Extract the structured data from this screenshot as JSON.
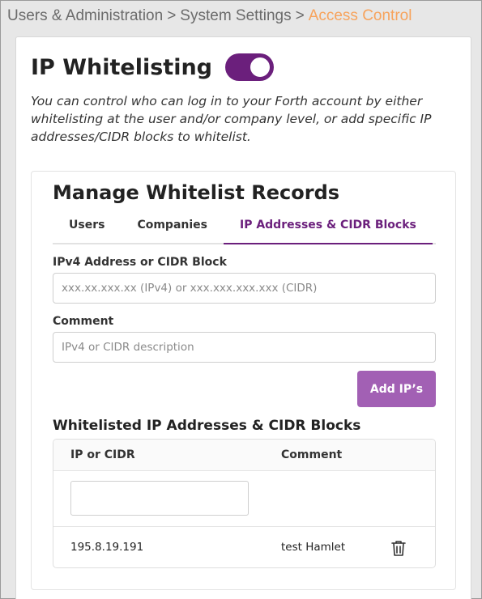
{
  "breadcrumb": {
    "items": [
      "Users & Administration",
      "System Settings"
    ],
    "separator": ">",
    "current": "Access Control"
  },
  "page": {
    "title": "IP Whitelisting",
    "toggle_on": true,
    "description": "You can control who can log in to your Forth account by either whitelisting at the user and/or company level, or add specific IP addresses/CIDR blocks to whitelist."
  },
  "manage": {
    "title": "Manage Whitelist Records",
    "tabs": [
      {
        "label": "Users",
        "active": false
      },
      {
        "label": "Companies",
        "active": false
      },
      {
        "label": "IP Addresses & CIDR Blocks",
        "active": true
      }
    ],
    "ip_field": {
      "label": "IPv4 Address or CIDR Block",
      "placeholder": "xxx.xx.xxx.xx (IPv4) or xxx.xxx.xxx.xxx (CIDR)",
      "value": ""
    },
    "comment_field": {
      "label": "Comment",
      "placeholder": "IPv4 or CIDR description",
      "value": ""
    },
    "add_button": "Add IP’s"
  },
  "whitelist": {
    "title": "Whitelisted IP Addresses & CIDR Blocks",
    "columns": [
      "IP or CIDR",
      "Comment"
    ],
    "rows": [
      {
        "ip": "195.8.19.191",
        "comment": "test Hamlet",
        "action_icon": "trash-icon"
      }
    ]
  },
  "colors": {
    "accent": "#6b1f7c",
    "button": "#a260b4",
    "breadcrumb_current": "#f7a35c"
  }
}
